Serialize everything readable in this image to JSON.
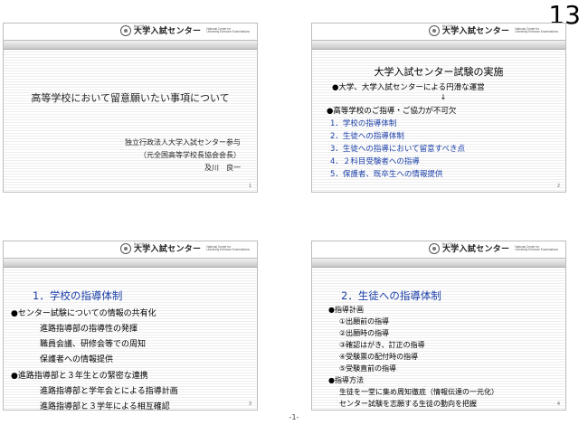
{
  "corner_page_number": "13",
  "footer_page": "-1-",
  "logo": {
    "small": "独立行政法人",
    "main": "大学入試センター",
    "en_line1": "National Center for",
    "en_line2": "University Entrance Examinations"
  },
  "slides": [
    {
      "number": "1",
      "title": "高等学校において留意願いたい事項について",
      "author": [
        "独立行政法人大学入試センター参与",
        "（元全国高等学校長協会会長）",
        "及川　良一"
      ]
    },
    {
      "number": "2",
      "title": "大学入試センター試験の実施",
      "line1": "●大学、大学入試センターによる円滑な運営",
      "arrow": "↓",
      "line2": "●高等学校のご指導・ご協力が不可欠",
      "items": [
        "1．学校の指導体制",
        "2．生徒への指導体制",
        "3．生徒への指導において留意すべき点",
        "4．２科目受験者への指導",
        "5．保護者、既卒生への情報提供"
      ]
    },
    {
      "number": "3",
      "title": "1．学校の指導体制",
      "lines": [
        "●センター試験についての情報の共有化",
        "進路指導部の指導性の発揮",
        "職員会議、研修会等での周知",
        "保護者への情報提供",
        "●進路指導部と３年生との緊密な連携",
        "進路指導部と学年会とによる指導計画",
        "進路指導部と３学年による相互確認"
      ]
    },
    {
      "number": "4",
      "title": "2．生徒への指導体制",
      "lines": [
        "●指導計画",
        "①出願前の指導",
        "②出願時の指導",
        "③確認はがき、訂正の指導",
        "④受験票の配付時の指導",
        "⑤受験直前の指導",
        "●指導方法",
        "生徒を一堂に集め周知徹底（情報伝達の一元化）",
        "センター試験を志願する生徒の動向を把握"
      ]
    }
  ]
}
